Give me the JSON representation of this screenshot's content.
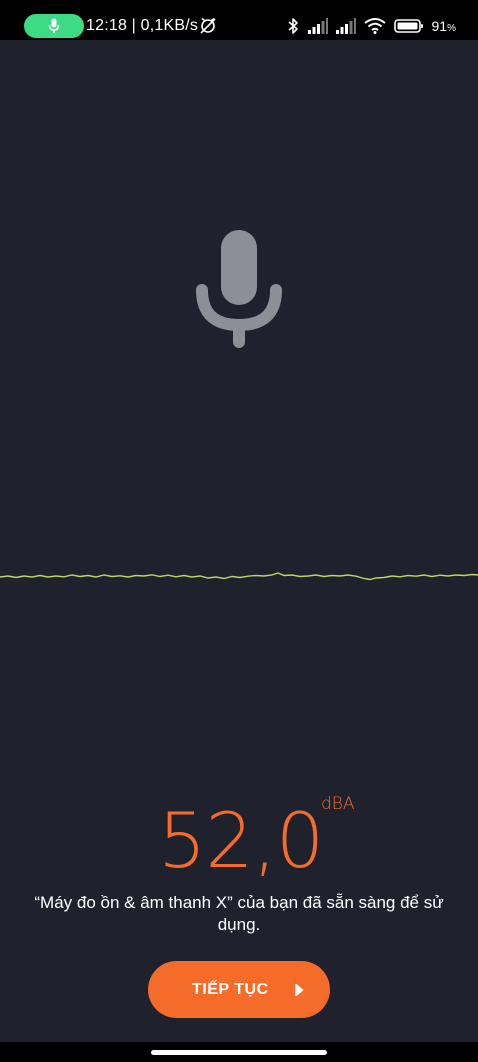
{
  "status_bar": {
    "time_speed": "12:18 | 0,1KB/s",
    "battery_percent": "91",
    "battery_suffix": "%",
    "icons": [
      "mic-active-icon",
      "alarm-off-icon",
      "bluetooth-icon",
      "signal-icon",
      "signal-icon",
      "wifi-icon",
      "battery-icon"
    ],
    "mic_indicator_color": "#3ddc84"
  },
  "main": {
    "mic_icon": "microphone-icon",
    "reading_value": "52,0",
    "reading_unit": "dBA",
    "ready_message": "“Máy đo ồn & âm thanh X” của bạn đã sẵn sàng để sử dụng.",
    "accent_color": "#f46b2a"
  },
  "continue_button": {
    "label": "TIẾP TỤC",
    "icon": "play-arrow-icon"
  }
}
